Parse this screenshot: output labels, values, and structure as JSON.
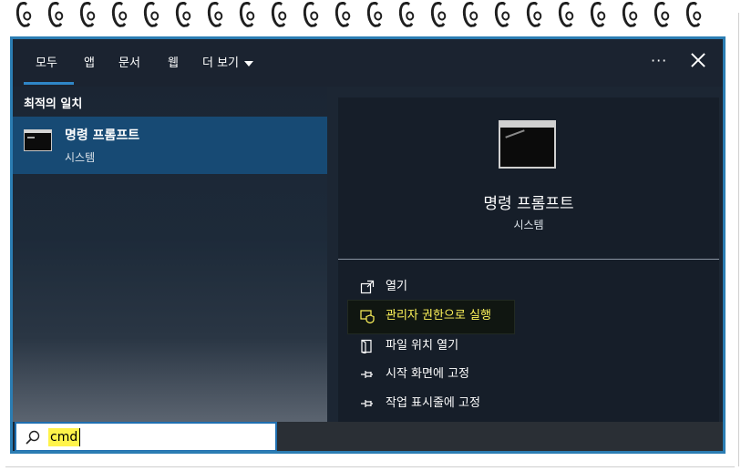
{
  "tabs": {
    "all": "모두",
    "apps": "앱",
    "documents": "문서",
    "web": "웹",
    "more": "더 보기"
  },
  "more_options": "···",
  "best_match": {
    "section_label": "최적의 일치",
    "title": "명령 프롬프트",
    "subtitle": "시스템"
  },
  "detail": {
    "title": "명령 프롬프트",
    "subtitle": "시스템"
  },
  "actions": {
    "open": "열기",
    "run_as_admin": "관리자 권한으로 실행",
    "open_file_location": "파일 위치 열기",
    "pin_to_start": "시작 화면에 고정",
    "pin_to_taskbar": "작업 표시줄에 고정"
  },
  "search": {
    "value": "cmd"
  },
  "icons": {
    "app": "command-prompt-icon",
    "open": "open-icon",
    "admin": "shield-icon",
    "folder": "folder-icon",
    "pin": "pin-icon",
    "search": "search-icon",
    "close": "close-icon"
  },
  "colors": {
    "accent": "#2f86c7",
    "selected_result": "#174a74",
    "highlight": "#fff45a",
    "frame": "#2b7db3"
  }
}
